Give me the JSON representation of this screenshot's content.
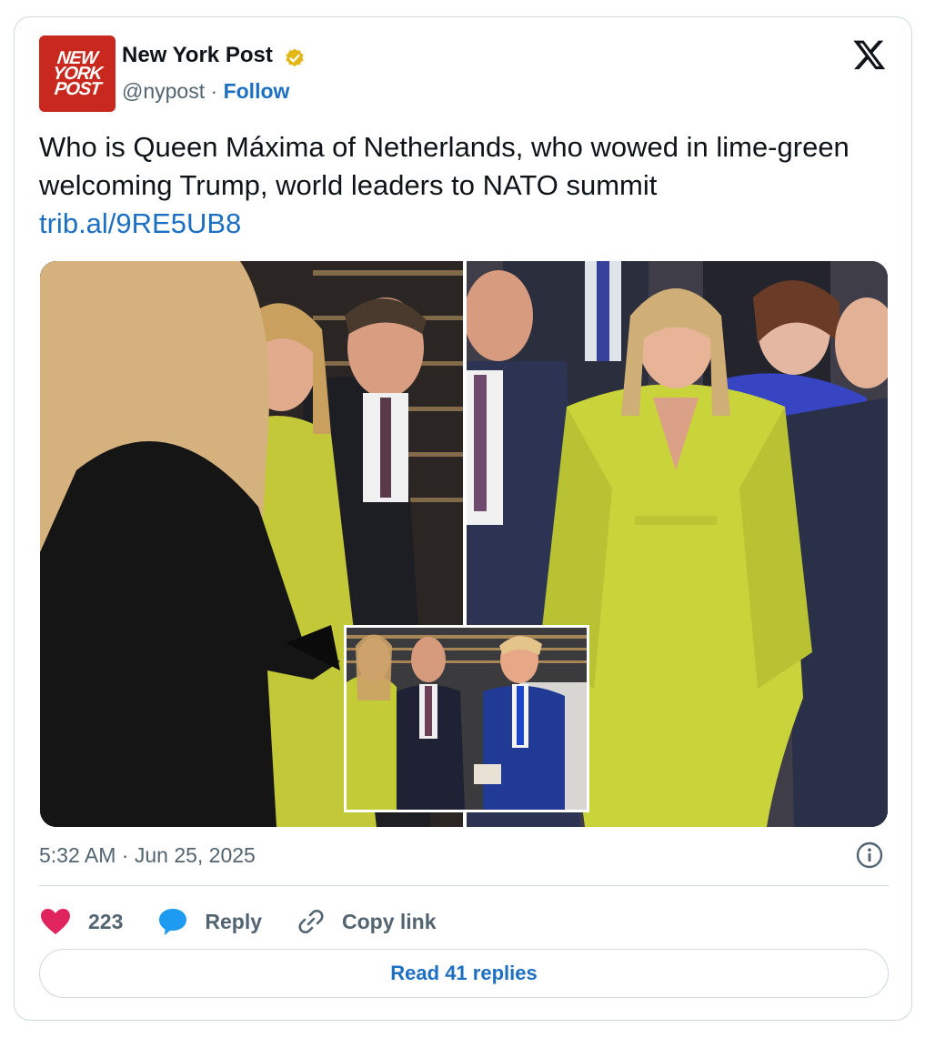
{
  "account": {
    "logo_lines": [
      "NEW",
      "YORK",
      "POST"
    ],
    "name": "New York Post",
    "handle": "@nypost",
    "separator": "·",
    "follow_label": "Follow"
  },
  "tweet": {
    "text": "Who is Queen Máxima of Netherlands, who wowed in lime-green welcoming Trump, world leaders to NATO summit",
    "link": "trib.al/9RE5UB8"
  },
  "meta": {
    "time": "5:32 AM",
    "separator": "·",
    "date": "Jun 25, 2025"
  },
  "actions": {
    "likes_count": "223",
    "reply_label": "Reply",
    "copy_link_label": "Copy link"
  },
  "read_replies_label": "Read 41 replies",
  "colors": {
    "accent": "#1d6fc2",
    "like": "#e0245e",
    "brand_red": "#c8281e",
    "verified_gold": "#e2b719",
    "lime_dress": "#c9d33a"
  },
  "icons": [
    "verified-badge-icon",
    "x-logo-icon",
    "info-icon",
    "heart-icon",
    "reply-bubble-icon",
    "link-icon"
  ]
}
